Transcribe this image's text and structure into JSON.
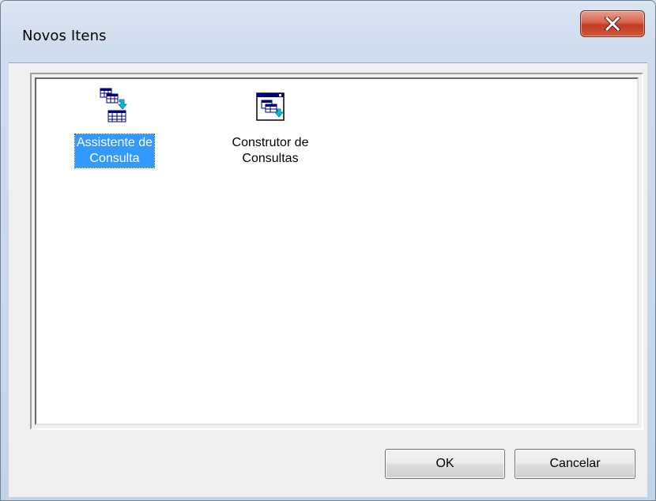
{
  "window": {
    "title": "Novos Itens",
    "close_icon": "close-x-icon"
  },
  "items": [
    {
      "label_line1": "Assistente de",
      "label_line2": "Consulta",
      "icon": "query-wizard-icon",
      "selected": true
    },
    {
      "label_line1": "Construtor de",
      "label_line2": "Consultas",
      "icon": "query-builder-icon",
      "selected": false
    }
  ],
  "buttons": {
    "ok_label": "OK",
    "cancel_label": "Cancelar"
  },
  "colors": {
    "selection": "#3399ff",
    "close_button": "#c23b22"
  }
}
